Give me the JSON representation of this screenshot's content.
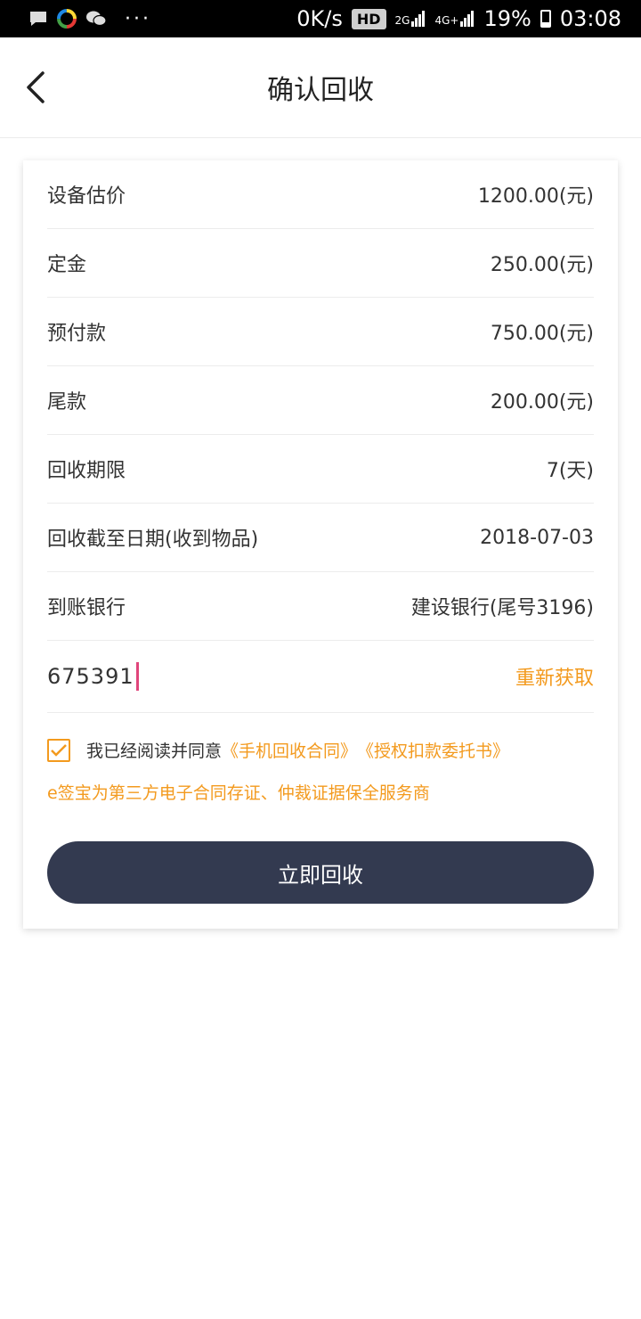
{
  "status_bar": {
    "speed": "0K/s",
    "hd": "HD",
    "net_2g": "2G",
    "net_4g": "4G+",
    "battery": "19%",
    "time": "03:08",
    "dots": "···"
  },
  "header": {
    "title": "确认回收"
  },
  "details": [
    {
      "label": "设备估价",
      "value": "1200.00(元)"
    },
    {
      "label": "定金",
      "value": "250.00(元)"
    },
    {
      "label": "预付款",
      "value": "750.00(元)"
    },
    {
      "label": "尾款",
      "value": "200.00(元)"
    },
    {
      "label": "回收期限",
      "value": "7(天)"
    },
    {
      "label": "回收截至日期(收到物品)",
      "value": "2018-07-03"
    },
    {
      "label": "到账银行",
      "value": "建设银行(尾号3196)"
    }
  ],
  "verification": {
    "code": "675391",
    "resend_label": "重新获取"
  },
  "agreement": {
    "checked": true,
    "text": "我已经阅读并同意",
    "contract_link": "《手机回收合同》",
    "authorization_link": "《授权扣款委托书》",
    "notice": "e签宝为第三方电子合同存证、仲裁证据保全服务商"
  },
  "submit_label": "立即回收",
  "colors": {
    "accent": "#f39a1e",
    "button": "#333a50",
    "caret": "#e0457b"
  }
}
